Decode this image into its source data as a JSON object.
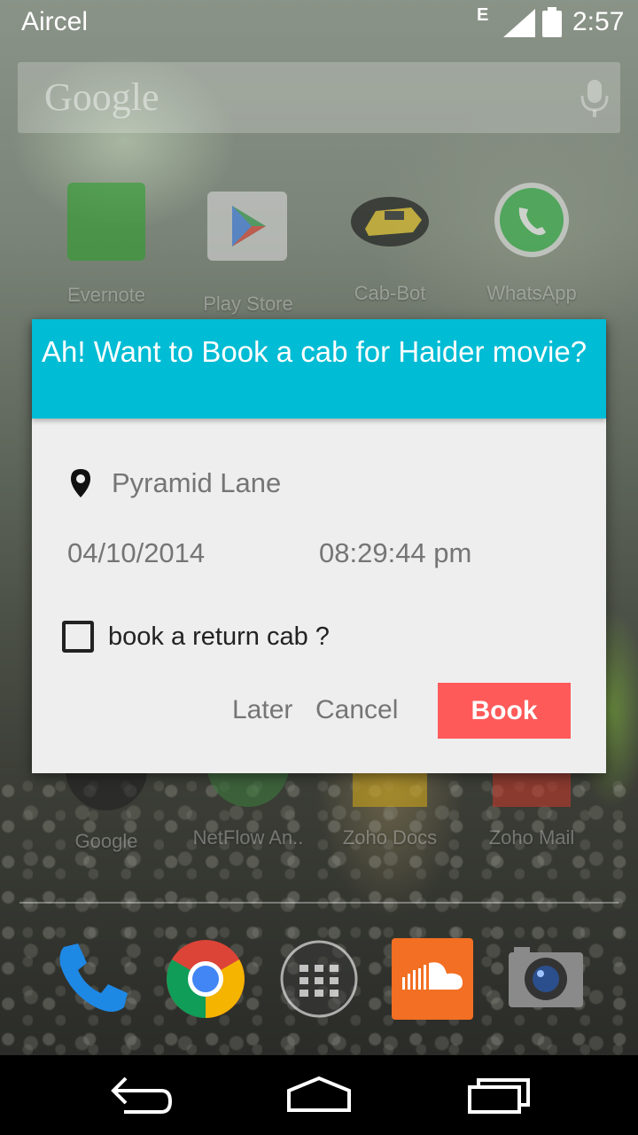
{
  "status_bar": {
    "carrier": "Aircel",
    "network_type": "E",
    "time": "2:57"
  },
  "search": {
    "logo_text": "Google"
  },
  "apps_row1": [
    {
      "label": "Evernote",
      "icon": "evernote-icon"
    },
    {
      "label": "Play Store",
      "icon": "play-store-icon"
    },
    {
      "label": "Cab-Bot",
      "icon": "cab-bot-icon"
    },
    {
      "label": "WhatsApp",
      "icon": "whatsapp-icon"
    }
  ],
  "apps_row2": [
    {
      "label": "Google",
      "icon": "google-folder-icon"
    },
    {
      "label": "NetFlow An..",
      "icon": "netflow-icon"
    },
    {
      "label": "Zoho Docs",
      "icon": "zoho-docs-icon"
    },
    {
      "label": "Zoho Mail",
      "icon": "zoho-mail-icon"
    }
  ],
  "dock": [
    {
      "name": "phone-icon"
    },
    {
      "name": "chrome-icon"
    },
    {
      "name": "app-drawer-icon"
    },
    {
      "name": "soundcloud-icon"
    },
    {
      "name": "camera-icon"
    }
  ],
  "dialog": {
    "title": "Ah! Want to Book a cab for Haider movie?",
    "location": "Pyramid Lane",
    "date": "04/10/2014",
    "time": "08:29:44 pm",
    "return_label": "book a return cab ?",
    "return_checked": false,
    "later_label": "Later",
    "cancel_label": "Cancel",
    "book_label": "Book",
    "header_color": "#00bcd4",
    "book_color": "#ff5a5a"
  },
  "nav_bar": {
    "buttons": [
      "back-icon",
      "home-icon",
      "recents-icon"
    ]
  }
}
